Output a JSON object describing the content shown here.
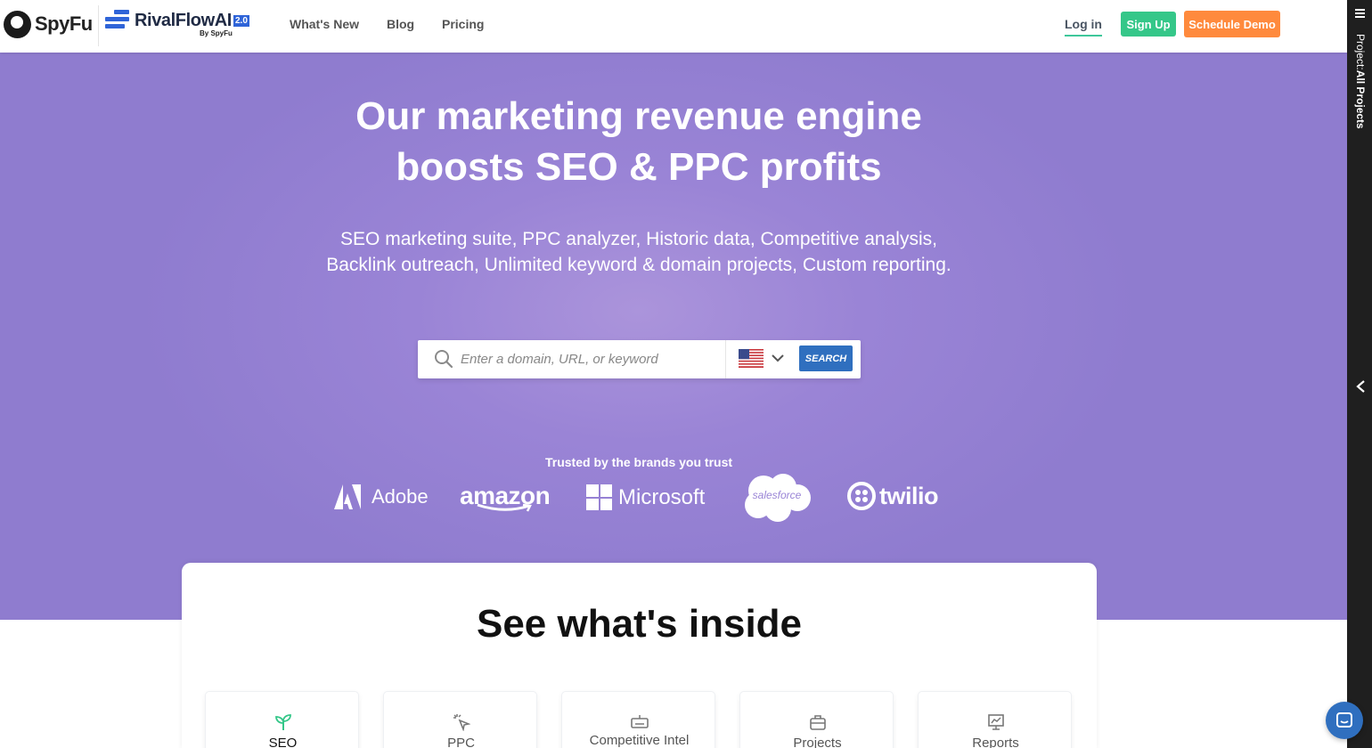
{
  "header": {
    "spyfu_logo": "SpyFu",
    "rivalflow_logo": "RivalFlowAI",
    "rivalflow_badge": "2.0",
    "rivalflow_by": "By SpyFu",
    "nav": {
      "whats_new": "What's New",
      "blog": "Blog",
      "pricing": "Pricing"
    },
    "login": "Log in",
    "signup": "Sign Up",
    "demo": "Schedule Demo"
  },
  "hero": {
    "title_line1": "Our marketing revenue engine",
    "title_line2": "boosts SEO & PPC profits",
    "subtitle": "SEO marketing suite, PPC analyzer, Historic data, Competitive analysis, Backlink outreach, Unlimited keyword & domain projects, Custom reporting.",
    "search": {
      "placeholder": "Enter a domain, URL, or keyword",
      "value": "",
      "country_flag": "us-flag-icon",
      "button": "SEARCH"
    },
    "trusted_label": "Trusted by the brands you trust",
    "brands": {
      "adobe": "Adobe",
      "amazon": "amazon",
      "microsoft": "Microsoft",
      "salesforce": "salesforce",
      "twilio": "twilio"
    }
  },
  "inside": {
    "title": "See what's inside",
    "tabs": [
      {
        "label": "SEO",
        "icon": "sprout-icon"
      },
      {
        "label": "PPC",
        "icon": "click-cursor-icon"
      },
      {
        "label": "Competitive Intel",
        "icon": "keyboard-icon"
      },
      {
        "label": "Projects",
        "icon": "briefcase-icon"
      },
      {
        "label": "Reports",
        "icon": "chart-board-icon"
      }
    ]
  },
  "side_panel": {
    "project_prefix": "Project:",
    "project_name": "All Projects"
  },
  "colors": {
    "hero_purple": "#9a84d6",
    "signup_green": "#35c789",
    "demo_orange": "#ff8a3d",
    "search_blue": "#2f6fbf",
    "rivalflow_blue": "#2f64d8",
    "seo_green": "#35c789"
  }
}
